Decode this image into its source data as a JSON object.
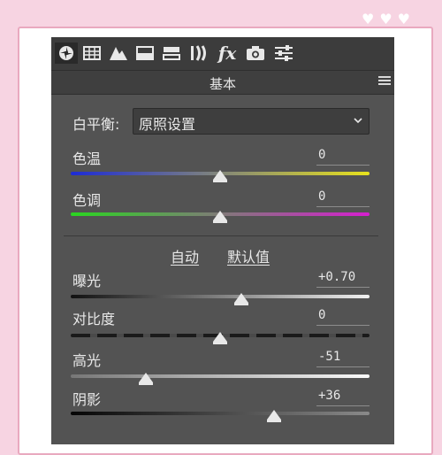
{
  "decor": {
    "hearts": [
      "♥",
      "♥",
      "♥"
    ]
  },
  "toolbar": {
    "icons": [
      "aperture-icon",
      "grid-icon",
      "mountains-icon",
      "split-tone-icon",
      "hsl-icon",
      "lens-icon",
      "fx-icon",
      "camera-icon",
      "sliders-icon"
    ],
    "fx_label": "fx"
  },
  "panel": {
    "title": "基本"
  },
  "white_balance": {
    "label": "白平衡:",
    "selected": "原照设置"
  },
  "controls": {
    "temp": {
      "label": "色温",
      "value": "0",
      "level": 0.5,
      "colors": [
        "#1d2bd6",
        "#e8e21d"
      ]
    },
    "tint": {
      "label": "色调",
      "value": "0",
      "level": 0.5,
      "colors": [
        "#2ad620",
        "#d61fd0"
      ]
    },
    "exposure": {
      "label": "曝光",
      "value": "+0.70",
      "level": 0.57
    },
    "contrast": {
      "label": "对比度",
      "value": "0",
      "level": 0.5
    },
    "highlights": {
      "label": "高光",
      "value": "-51",
      "level": 0.25
    },
    "shadows": {
      "label": "阴影",
      "value": "+36",
      "level": 0.68
    }
  },
  "tone": {
    "auto_label": "自动",
    "default_label": "默认值"
  }
}
